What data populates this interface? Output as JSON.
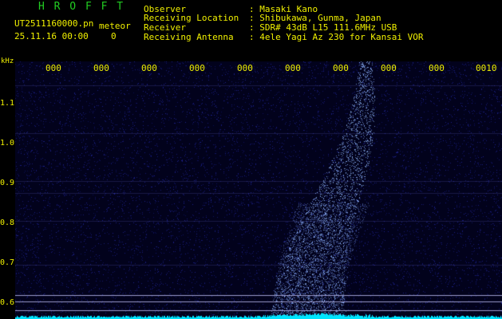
{
  "header": {
    "logo": "H R O F F T",
    "filename": "UT2511160000.pn",
    "mode": "meteor",
    "datetime": "25.11.16 00:00",
    "count": "0"
  },
  "info": {
    "observer_label": "Observer",
    "observer_value": ": Masaki Kano",
    "location_label": "Receiving Location",
    "location_value": ": Shibukawa, Gunma, Japan",
    "receiver_label": "Receiver",
    "receiver_value": ": SDR# 43dB L15 111.6MHz USB",
    "antenna_label": "Receiving Antenna",
    "antenna_value": ": 4ele Yagi Az 230 for Kansai VOR"
  },
  "axes": {
    "y_unit": "kHz",
    "x_ticks": [
      "000",
      "000",
      "000",
      "000",
      "000",
      "000",
      "000",
      "000",
      "000",
      "0010"
    ],
    "y_ticks": [
      "1.1",
      "1.0",
      "0.9",
      "0.8",
      "0.7",
      "0.6"
    ]
  },
  "colors": {
    "text": "#f0f000",
    "logo": "#22cc22",
    "background": "#000000",
    "waterfall_bg": "#02021c",
    "signal": "#8fb4ff",
    "spectrum": "#00e5ff",
    "marker_lines": "#9a9acc"
  }
}
